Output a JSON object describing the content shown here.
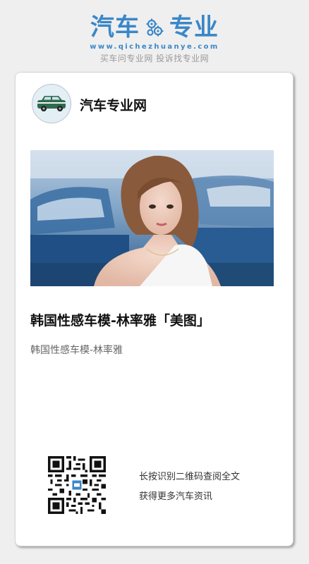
{
  "brand": {
    "logo_left": "汽车",
    "logo_right": "专业",
    "url": "www.qichezhuanye.com",
    "tagline": "买车问专业网 投诉找专业网",
    "color": "#3a87c8"
  },
  "card": {
    "site_name": "汽车专业网",
    "avatar_icon": "car-icon",
    "title": "韩国性感车模-林率雅「美图」",
    "subtitle": "韩国性感车模-林率雅",
    "qr_line1": "长按识别二维码查阅全文",
    "qr_line2": "获得更多汽车资讯"
  }
}
